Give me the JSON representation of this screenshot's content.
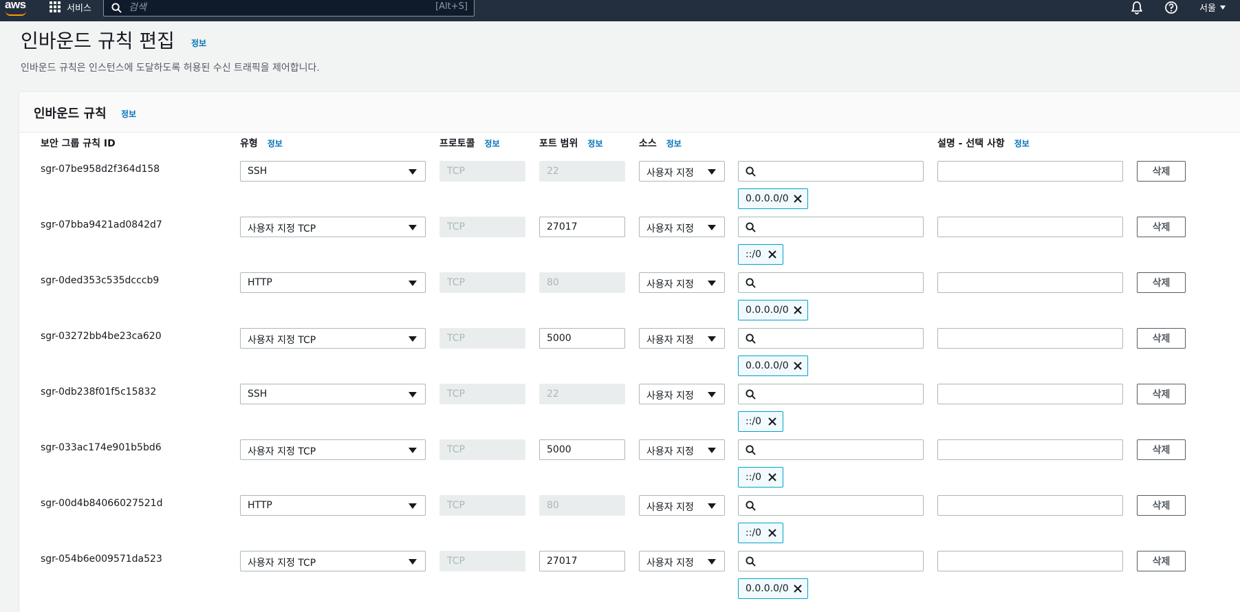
{
  "nav": {
    "services": "서비스",
    "search_placeholder": "검색",
    "search_shortcut": "[Alt+S]",
    "region": "서울",
    "brand_color": "#ff9900"
  },
  "page": {
    "title": "인바운드 규칙 편집",
    "info": "정보",
    "description": "인바운드 규칙은 인스턴스에 도달하도록 허용된 수신 트래픽을 제어합니다."
  },
  "panel": {
    "title": "인바운드 규칙",
    "info": "정보"
  },
  "columns": {
    "rule_id": "보안 그룹 규칙 ID",
    "type": "유형",
    "protocol": "프로토콜",
    "port_range": "포트 범위",
    "source": "소스",
    "description": "설명 - 선택 사항",
    "info": "정보"
  },
  "delete_label": "삭제",
  "rules": [
    {
      "id": "sgr-07be958d2f364d158",
      "type": "SSH",
      "protocol": "TCP",
      "port": "22",
      "port_editable": false,
      "source": "사용자 지정",
      "cidr": "0.0.0.0/0"
    },
    {
      "id": "sgr-07bba9421ad0842d7",
      "type": "사용자 지정 TCP",
      "protocol": "TCP",
      "port": "27017",
      "port_editable": true,
      "source": "사용자 지정",
      "cidr": "::/0"
    },
    {
      "id": "sgr-0ded353c535dcccb9",
      "type": "HTTP",
      "protocol": "TCP",
      "port": "80",
      "port_editable": false,
      "source": "사용자 지정",
      "cidr": "0.0.0.0/0"
    },
    {
      "id": "sgr-03272bb4be23ca620",
      "type": "사용자 지정 TCP",
      "protocol": "TCP",
      "port": "5000",
      "port_editable": true,
      "source": "사용자 지정",
      "cidr": "0.0.0.0/0"
    },
    {
      "id": "sgr-0db238f01f5c15832",
      "type": "SSH",
      "protocol": "TCP",
      "port": "22",
      "port_editable": false,
      "source": "사용자 지정",
      "cidr": "::/0"
    },
    {
      "id": "sgr-033ac174e901b5bd6",
      "type": "사용자 지정 TCP",
      "protocol": "TCP",
      "port": "5000",
      "port_editable": true,
      "source": "사용자 지정",
      "cidr": "::/0"
    },
    {
      "id": "sgr-00d4b84066027521d",
      "type": "HTTP",
      "protocol": "TCP",
      "port": "80",
      "port_editable": false,
      "source": "사용자 지정",
      "cidr": "::/0"
    },
    {
      "id": "sgr-054b6e009571da523",
      "type": "사용자 지정 TCP",
      "protocol": "TCP",
      "port": "27017",
      "port_editable": true,
      "source": "사용자 지정",
      "cidr": "0.0.0.0/0"
    }
  ]
}
